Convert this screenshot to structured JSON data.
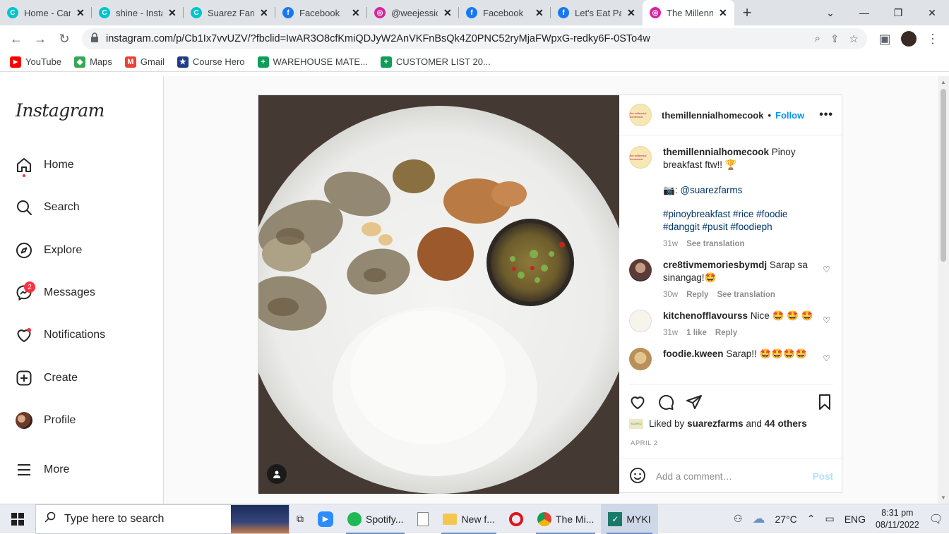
{
  "browser": {
    "tabs": [
      {
        "label": "Home - Canva",
        "icon": "canva-icon",
        "color": "#00c4cc"
      },
      {
        "label": "shine - Instagram",
        "icon": "canva-icon",
        "color": "#00c4cc"
      },
      {
        "label": "Suarez Farms",
        "icon": "canva-icon",
        "color": "#00c4cc"
      },
      {
        "label": "Facebook",
        "icon": "facebook-icon",
        "color": "#1877f2"
      },
      {
        "label": "@weejessica",
        "icon": "instagram-icon",
        "color": "#d6249f"
      },
      {
        "label": "Facebook",
        "icon": "facebook-icon",
        "color": "#1877f2"
      },
      {
        "label": "Let's Eat Pare",
        "icon": "facebook-icon",
        "color": "#1877f2"
      },
      {
        "label": "The Millennial",
        "icon": "instagram-icon",
        "color": "#d6249f"
      }
    ],
    "url": "instagram.com/p/Cb1Ix7vvUZV/?fbclid=IwAR3O8cfKmiQDJyW2AnVKFnBsQk4Z0PNC52ryMjaFWpxG-redky6F-0STo4w",
    "bookmarks": [
      {
        "label": "YouTube",
        "icon": "youtube-icon",
        "color": "#ff0000"
      },
      {
        "label": "Maps",
        "icon": "maps-icon",
        "color": "#34a853"
      },
      {
        "label": "Gmail",
        "icon": "gmail-icon",
        "color": "#ea4335"
      },
      {
        "label": "Course Hero",
        "icon": "coursehero-icon",
        "color": "#1f3c88"
      },
      {
        "label": "WAREHOUSE MATE...",
        "icon": "sheets-icon",
        "color": "#0f9d58"
      },
      {
        "label": "CUSTOMER LIST 20...",
        "icon": "sheets-icon",
        "color": "#0f9d58"
      }
    ]
  },
  "sidebar": {
    "logo": "Instagram",
    "items": [
      {
        "label": "Home"
      },
      {
        "label": "Search"
      },
      {
        "label": "Explore"
      },
      {
        "label": "Messages",
        "badge": "2"
      },
      {
        "label": "Notifications"
      },
      {
        "label": "Create"
      },
      {
        "label": "Profile"
      },
      {
        "label": "More"
      }
    ]
  },
  "post": {
    "username": "themillennialhomecook",
    "follow": "Follow",
    "caption": {
      "username": "themillennialhomecook",
      "text": "Pinoy breakfast ftw!! 🏆",
      "credit_prefix": ":",
      "credit_tag": "@suarezfarms",
      "hashtags": "#pinoybreakfast #rice #foodie #danggit #pusit #foodieph",
      "time": "31w",
      "see_translation": "See translation"
    },
    "comments": [
      {
        "username": "cre8tivmemoriesbymdj",
        "text": "Sarap sa sinangag!🤩",
        "time": "30w",
        "reply": "Reply",
        "translate": "See translation"
      },
      {
        "username": "kitchenofflavourss",
        "text": "Nice 🤩 🤩 🤩",
        "time": "31w",
        "likes": "1 like",
        "reply": "Reply"
      },
      {
        "username": "foodie.kween",
        "text": "Sarap!! 🤩🤩🤩🤩"
      }
    ],
    "liked_prefix": "Liked by",
    "liked_by": "suarezfarms",
    "liked_and": "and",
    "liked_others": "44 others",
    "date": "APRIL 2",
    "comment_placeholder": "Add a comment…",
    "post_button": "Post"
  },
  "taskbar": {
    "search_placeholder": "Type here to search",
    "apps": [
      {
        "label": "Spotify..."
      },
      {
        "label": "New f..."
      },
      {
        "label": "The Mi..."
      },
      {
        "label": "MYKI"
      }
    ],
    "weather": "27°C",
    "language": "ENG",
    "time": "8:31 pm",
    "date": "08/11/2022"
  },
  "colors": {
    "accent": "#0095f6",
    "notification_red": "#ff3040"
  }
}
